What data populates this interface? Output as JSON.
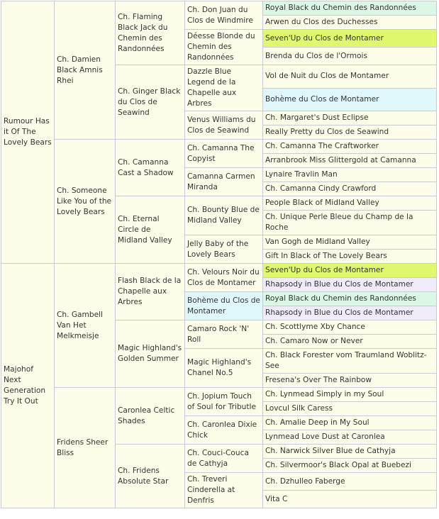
{
  "colors": {
    "background": "#fdfde9",
    "border": "#c4ccd4",
    "green": "#dcf7e6",
    "yellow": "#e0f870",
    "cyan": "#e0f8fc",
    "lavender": "#f0ecfa"
  },
  "generations": [
    [
      {
        "name": "Rumour Has it Of The Lovely Bears"
      },
      {
        "name": "Majohof Next Generation Try It Out"
      }
    ],
    [
      {
        "name": "Ch. Damien Black Amnis Rhei"
      },
      {
        "name": "Ch. Someone Like You of the Lovely Bears"
      },
      {
        "name": "Ch. Gambell Van Het Melkmeisje"
      },
      {
        "name": "Fridens Sheer Bliss"
      }
    ],
    [
      {
        "name": "Ch. Flaming Black Jack du Chemin des Randonnées"
      },
      {
        "name": "Ch. Ginger Black du Clos de Seawind"
      },
      {
        "name": "Ch. Camanna Cast a Shadow"
      },
      {
        "name": "Ch. Eternal Circle de Midland Valley"
      },
      {
        "name": "Flash Black de la Chapelle aux Arbres"
      },
      {
        "name": "Magic Highland's Golden Summer"
      },
      {
        "name": "Caronlea Celtic Shades"
      },
      {
        "name": "Ch. Fridens Absolute Star"
      }
    ],
    [
      {
        "name": "Ch. Don Juan du Clos de Windmire"
      },
      {
        "name": "Déesse Blonde du Chemin des Randonnées"
      },
      {
        "name": "Dazzle Blue Legend de la Chapelle aux Arbres"
      },
      {
        "name": "Venus Williams du Clos de Seawind"
      },
      {
        "name": "Ch. Camanna The Copyist"
      },
      {
        "name": "Camanna Carmen Miranda"
      },
      {
        "name": "Ch. Bounty Blue de Midland Valley"
      },
      {
        "name": "Jelly Baby of the Lovely Bears"
      },
      {
        "name": "Ch. Velours Noir du Clos de Montamer"
      },
      {
        "name": "Bohème du Clos de Montamer",
        "hl": "cyan"
      },
      {
        "name": "Camaro Rock 'N' Roll"
      },
      {
        "name": "Magic Highland's Chanel No.5"
      },
      {
        "name": "Ch. Jopium Touch of Soul for Tributle"
      },
      {
        "name": "Ch. Caronlea Dixie Chick"
      },
      {
        "name": "Ch. Couci-Couca de Cathyja"
      },
      {
        "name": "Ch. Treveri Cinderella at Denfris"
      }
    ],
    [
      {
        "name": "Royal Black du Chemin des Randonnées",
        "hl": "green"
      },
      {
        "name": "Arwen du Clos des Duchesses"
      },
      {
        "name": "Seven'Up du Clos de Montamer",
        "hl": "yellow"
      },
      {
        "name": "Brenda du Clos de l'Ormois"
      },
      {
        "name": "Vol de Nuit du Clos de Montamer"
      },
      {
        "name": "Bohème du Clos de Montamer",
        "hl": "cyan"
      },
      {
        "name": "Ch. Margaret's Dust Eclipse"
      },
      {
        "name": "Really Pretty du Clos de Seawind"
      },
      {
        "name": "Ch. Camanna The Craftworker"
      },
      {
        "name": "Arranbrook Miss Glittergold at Camanna"
      },
      {
        "name": "Lynaire Travlin Man"
      },
      {
        "name": "Ch. Camanna Cindy Crawford"
      },
      {
        "name": "People Black of Midland Valley"
      },
      {
        "name": "Ch. Unique Perle Bleue du Champ de la Roche"
      },
      {
        "name": "Van Gogh de Midland Valley"
      },
      {
        "name": "Gift In Black of The Lovely Bears"
      },
      {
        "name": "Seven'Up du Clos de Montamer",
        "hl": "yellow"
      },
      {
        "name": "Rhapsody in Blue du Clos de Montamer",
        "hl": "lavender"
      },
      {
        "name": "Royal Black du Chemin des Randonnées",
        "hl": "green"
      },
      {
        "name": "Rhapsody in Blue du Clos de Montamer",
        "hl": "lavender"
      },
      {
        "name": "Ch. Scottlyme Xby Chance"
      },
      {
        "name": "Ch. Camaro Now or Never"
      },
      {
        "name": "Ch. Black Forester vom Traumland Woblitz-See"
      },
      {
        "name": "Fresena's Over The Rainbow"
      },
      {
        "name": "Ch. Lynmead Simply in my Soul"
      },
      {
        "name": "Lovcul Silk Caress"
      },
      {
        "name": "Ch. Amalie Deep in My Soul"
      },
      {
        "name": "Lynmead Love Dust at Caronlea"
      },
      {
        "name": "Ch. Narwick Silver Blue de Cathyja"
      },
      {
        "name": "Ch. Silvermoor's Black Opal at Buebezi"
      },
      {
        "name": "Ch. Dzhulleo Faberge"
      },
      {
        "name": "Vita C"
      }
    ]
  ]
}
